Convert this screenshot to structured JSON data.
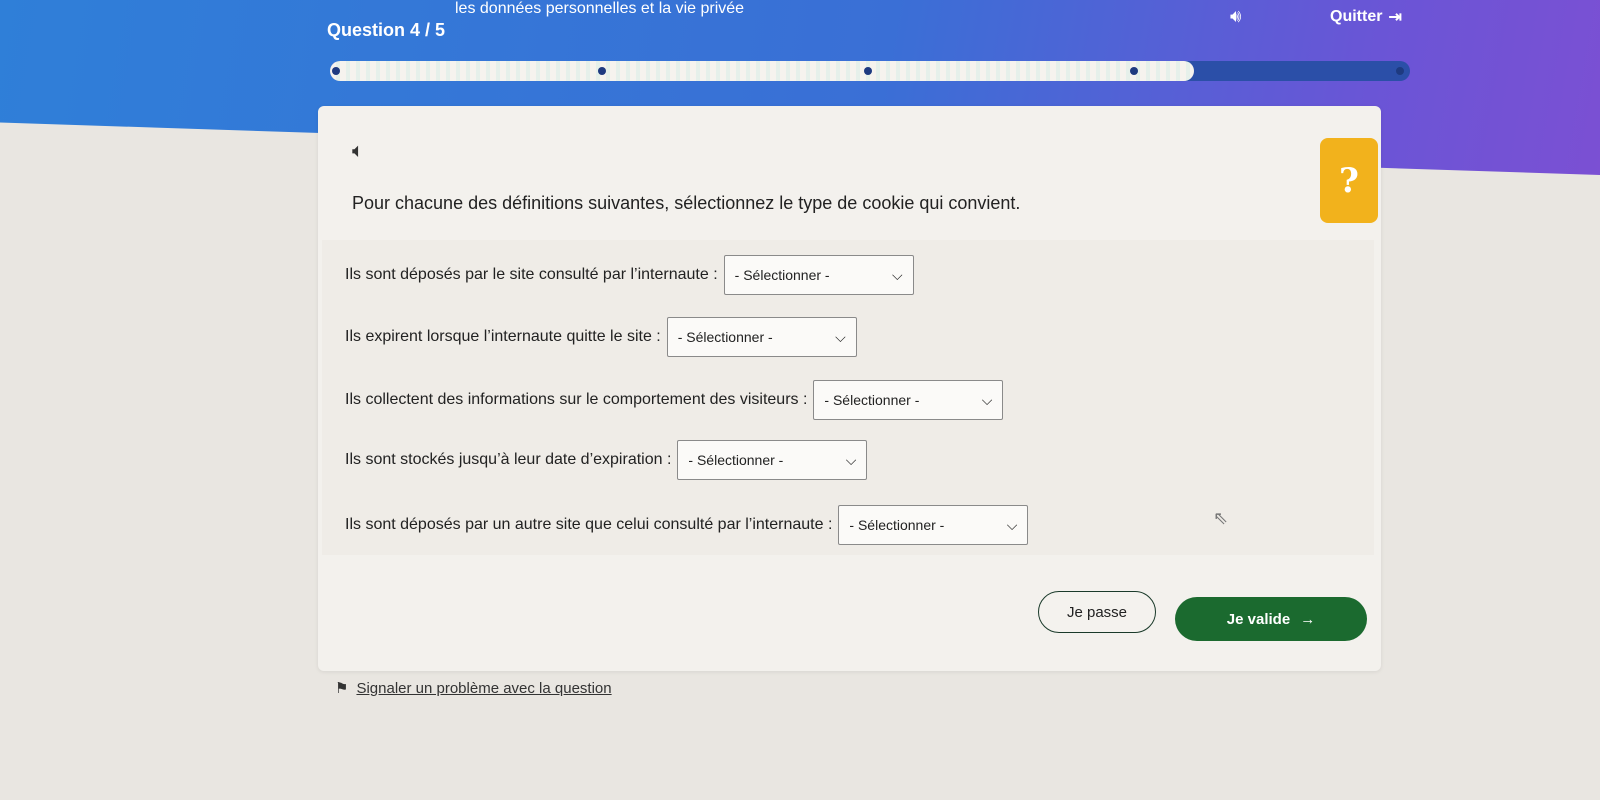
{
  "header": {
    "topic": "les données personnelles et la vie privée",
    "question_count": "Question 4 / 5",
    "quit_label": "Quitter",
    "quit_icon": "exit-icon",
    "sound_icon": "speaker-icon"
  },
  "progress": {
    "current": 4,
    "total": 5
  },
  "card": {
    "instruction": "Pour chacune des définitions suivantes, sélectionnez le type de cookie qui convient.",
    "help_symbol": "?",
    "questions": [
      {
        "text": "Ils sont déposés par le site consulté par l’internaute :",
        "select_value": "- Sélectionner -"
      },
      {
        "text": "Ils expirent lorsque l’internaute quitte le site :",
        "select_value": "- Sélectionner -"
      },
      {
        "text": "Ils collectent des informations sur le comportement des visiteurs :",
        "select_value": "- Sélectionner -"
      },
      {
        "text": "Ils sont stockés jusqu’à leur date d’expiration :",
        "select_value": "- Sélectionner -"
      },
      {
        "text": "Ils sont déposés par un autre site que celui consulté par l’internaute :",
        "select_value": "- Sélectionner -"
      }
    ]
  },
  "actions": {
    "skip_label": "Je passe",
    "validate_label": "Je valide",
    "validate_arrow": "→"
  },
  "report": {
    "label": "Signaler un problème avec la question"
  },
  "colors": {
    "header_blue": "#2f7fd8",
    "header_purple": "#7b50d3",
    "help_yellow": "#f2b21c",
    "validate_green": "#1b6a2f"
  }
}
